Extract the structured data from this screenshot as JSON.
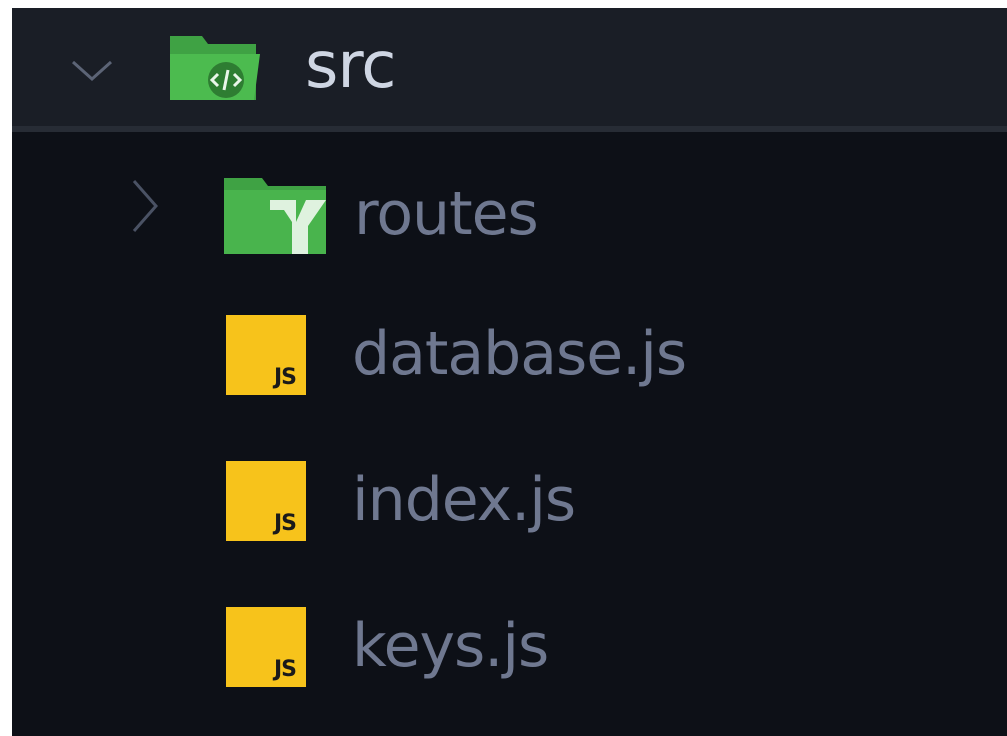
{
  "explorer": {
    "folder": {
      "name": "src",
      "expanded": true,
      "icon": "folder-src-open-icon",
      "icon_color": "#3fa244",
      "children": [
        {
          "name": "routes",
          "type": "folder",
          "expanded": false,
          "icon": "folder-routes-icon",
          "icon_color": "#3fa244"
        },
        {
          "name": "database.js",
          "type": "file",
          "icon": "javascript-file-icon",
          "badge_text": "JS",
          "badge_color": "#f7c31b"
        },
        {
          "name": "index.js",
          "type": "file",
          "icon": "javascript-file-icon",
          "badge_text": "JS",
          "badge_color": "#f7c31b"
        },
        {
          "name": "keys.js",
          "type": "file",
          "icon": "javascript-file-icon",
          "badge_text": "JS",
          "badge_color": "#f7c31b"
        }
      ]
    },
    "colors": {
      "background": "#0d1017",
      "selected_row": "#1a1e26",
      "label_active": "#cfd6e3",
      "label_inactive": "#6f7890"
    }
  }
}
